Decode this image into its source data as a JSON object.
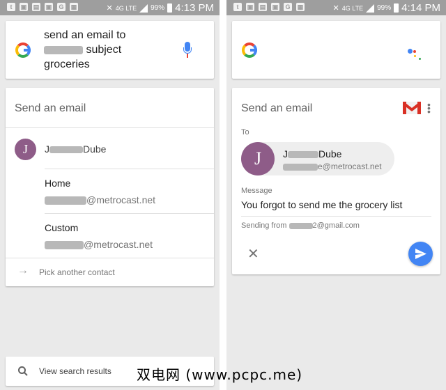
{
  "status_left": {
    "battery": "99%",
    "time": "4:13 PM",
    "network": "4G LTE"
  },
  "status_right": {
    "battery": "99%",
    "time": "4:14 PM",
    "network": "4G LTE"
  },
  "left": {
    "query_line1": "send an email to",
    "query_line2_suffix": "subject",
    "query_line3": "groceries",
    "card_title": "Send an email",
    "contact_initial": "J",
    "contact_name_prefix": "J",
    "contact_name_suffix": "Dube",
    "option1_label": "Home",
    "option1_email_suffix": "@metrocast.net",
    "option2_label": "Custom",
    "option2_email_suffix": "@metrocast.net",
    "pick_another": "Pick another contact",
    "view_results": "View search results"
  },
  "right": {
    "card_title": "Send an email",
    "to_label": "To",
    "recipient_initial": "J",
    "recipient_name_prefix": "J",
    "recipient_name_suffix": "Dube",
    "recipient_email_suffix": "e@metrocast.net",
    "message_label": "Message",
    "message_text": "You forgot to send me the grocery list",
    "sending_prefix": "Sending from",
    "sending_suffix": "2@gmail.com"
  },
  "watermark": "双电网 (www.pcpc.me)",
  "colors": {
    "avatar": "#8e5c88",
    "send_button": "#4285f4",
    "gmail_red": "#d93025",
    "status_bar": "#9e9e9e"
  }
}
